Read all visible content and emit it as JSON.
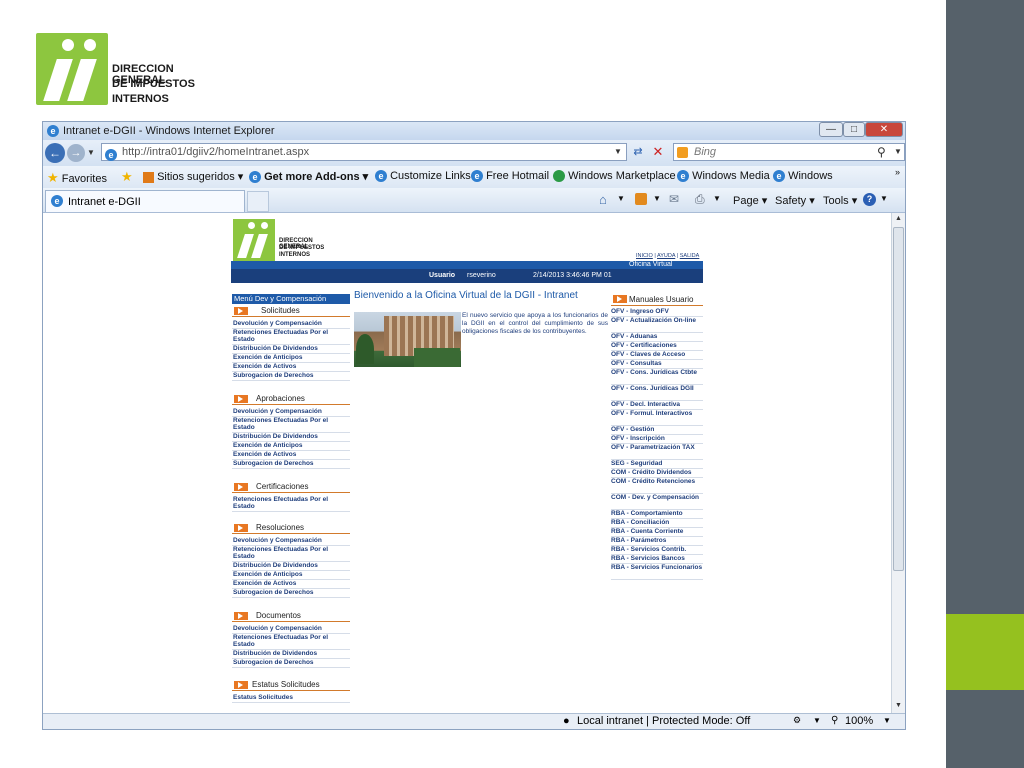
{
  "slide": {
    "logo_lines": [
      "DIRECCION GENERAL",
      "DE IMPUESTOS",
      "INTERNOS"
    ],
    "colors": {
      "green": "#95c11f",
      "slate": "#56616a"
    }
  },
  "browser": {
    "title": "Intranet e-DGII - Windows Internet Explorer",
    "address_url": "http://intra01/dgiiv2/homeIntranet.aspx",
    "search_placeholder": "Bing",
    "favorites": {
      "favorites_label": "Favorites",
      "sitios_label": "Sitios sugeridos ▾",
      "addons_label": "Get more Add-ons ▾",
      "customize_label": "Customize Links",
      "hotmail_label": "Free Hotmail",
      "marketplace_label": "Windows Marketplace",
      "media_label": "Windows Media",
      "windows_label": "Windows"
    },
    "tab_label": "Intranet e-DGII",
    "tools": {
      "page_label": "Page ▾",
      "safety_label": "Safety ▾",
      "tools_label": "Tools ▾"
    },
    "status": {
      "zone": "Local intranet | Protected Mode: Off",
      "zoom": "100%"
    }
  },
  "intranet": {
    "logo_lines": [
      "DIRECCION GENERAL",
      "DE IMPUESTOS",
      "INTERNOS"
    ],
    "top_links": [
      "INICIO",
      "AYUDA",
      "SALIDA"
    ],
    "virtual_office": "Oficina Virtual",
    "user_label": "Usuario",
    "user_name": "rseverino",
    "datetime": "2/14/2013 3:46:46 PM 01",
    "menu_title": "Menú Dev y Compensación",
    "welcome_title": "Bienvenido a la Oficina Virtual de la DGII - Intranet",
    "welcome_text": "El nuevo servicio que apoya a los funcionarios de la DGII en el control del cumplimiento de sus obligaciones fiscales de los contribuyentes.",
    "sections": [
      {
        "title": "Solicitudes",
        "items": [
          "Devolución y Compensación",
          "Retenciones Efectuadas Por el Estado",
          "Distribución De Dividendos",
          "Exención de Anticipos",
          "Exención de Activos",
          "Subrogacion de Derechos"
        ]
      },
      {
        "title": "Aprobaciones",
        "items": [
          "Devolución y Compensación",
          "Retenciones Efectuadas Por el Estado",
          "Distribución De Dividendos",
          "Exención de Anticipos",
          "Exención de Activos",
          "Subrogacion de Derechos"
        ]
      },
      {
        "title": "Certificaciones",
        "items": [
          "Retenciones Efectuadas Por el Estado"
        ]
      },
      {
        "title": "Resoluciones",
        "items": [
          "Devolución y Compensación",
          "Retenciones Efectuadas Por el Estado",
          "Distribución De Dividendos",
          "Exención de Anticipos",
          "Exención de Activos",
          "Subrogacion de Derechos"
        ]
      },
      {
        "title": "Documentos",
        "items": [
          "Devolución y Compensación",
          "Retenciones Efectuadas Por el Estado",
          "Distribución de Dividendos",
          "Subrogacion de Derechos"
        ]
      },
      {
        "title": "Estatus Solicitudes",
        "items": [
          "Estatus Solicitudes"
        ]
      }
    ],
    "manuals_title": "Manuales Usuario",
    "manuals": [
      "OFV - Ingreso OFV",
      "OFV - Actualización On-line",
      "OFV - Aduanas",
      "OFV - Certificaciones",
      "OFV - Claves de Acceso",
      "OFV - Consultas",
      "OFV - Cons. Jurídicas Ctbte",
      "OFV - Cons. Jurídicas DGII",
      "OFV - Decl. Interactiva",
      "OFV - Formul. Interactivos",
      "OFV - Gestión",
      "OFV - Inscripción",
      "OFV - Parametrización TAX",
      "SEG - Seguridad",
      "COM - Crédito Dividendos",
      "COM - Crédito Retenciones",
      "COM - Dev. y Compensación",
      "RBA - Comportamiento",
      "RBA - Conciliación",
      "RBA - Cuenta Corriente",
      "RBA - Parámetros",
      "RBA - Servicios Contrib.",
      "RBA - Servicios Bancos",
      "RBA - Servicios Funcionarios"
    ]
  }
}
